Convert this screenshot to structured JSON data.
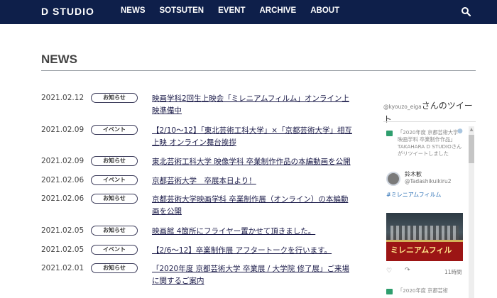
{
  "header": {
    "logo": "D STUDIO",
    "nav": [
      "NEWS",
      "SOTSUTEN",
      "EVENT",
      "ARCHIVE",
      "ABOUT"
    ]
  },
  "section": {
    "title": "NEWS"
  },
  "news": [
    {
      "date": "2021.02.12",
      "badge": "お知らせ",
      "title": "映画学科2回生上映会「ミレニアムフィルム」オンライン上映準備中"
    },
    {
      "date": "2021.02.09",
      "badge": "イベント",
      "title": "【2/10～12】「東北芸術工科大学」×「京都芸術大学」相互上映 オンライン舞台挨拶"
    },
    {
      "date": "2021.02.09",
      "badge": "お知らせ",
      "title": "東北芸術工科大学 映像学科 卒業制作作品の本編動画を公開"
    },
    {
      "date": "2021.02.06",
      "badge": "イベント",
      "title": "京都芸術大学　卒展本日より！"
    },
    {
      "date": "2021.02.06",
      "badge": "お知らせ",
      "title": "京都芸術大学映画学科 卒業制作展（オンライン）の本編動画を公開"
    },
    {
      "date": "2021.02.05",
      "badge": "お知らせ",
      "title": "映画館 4箇所にフライヤー置かせて頂きました。"
    },
    {
      "date": "2021.02.05",
      "badge": "イベント",
      "title": "【2/6～12】卒業制作展 アフタートークを行います。"
    },
    {
      "date": "2021.02.01",
      "badge": "お知らせ",
      "title": "「2020年度 京都芸術大学 卒業展 / 大学院 修了展」ご来場に関するご案内"
    }
  ],
  "twitter": {
    "handle": "@kyouzo_eiga",
    "head_suffix": "さんのツイート",
    "retweet_text": "「2020年度 京都芸術大学 映画学科 卒業制作作品」TAKAHARA D STUDIOさんがリツイートしました",
    "user_name": "鈴木歓",
    "user_handle": "@Tadashikuikiru2",
    "hashtag": "#ミレニアムフィルム",
    "photo_caption": "ミレニアムフィル",
    "time": "11時間",
    "next_text": "「2020年度 京都芸術"
  },
  "colors": {
    "header_bg": "#0e1f4a",
    "link": "#1c1c4a"
  }
}
